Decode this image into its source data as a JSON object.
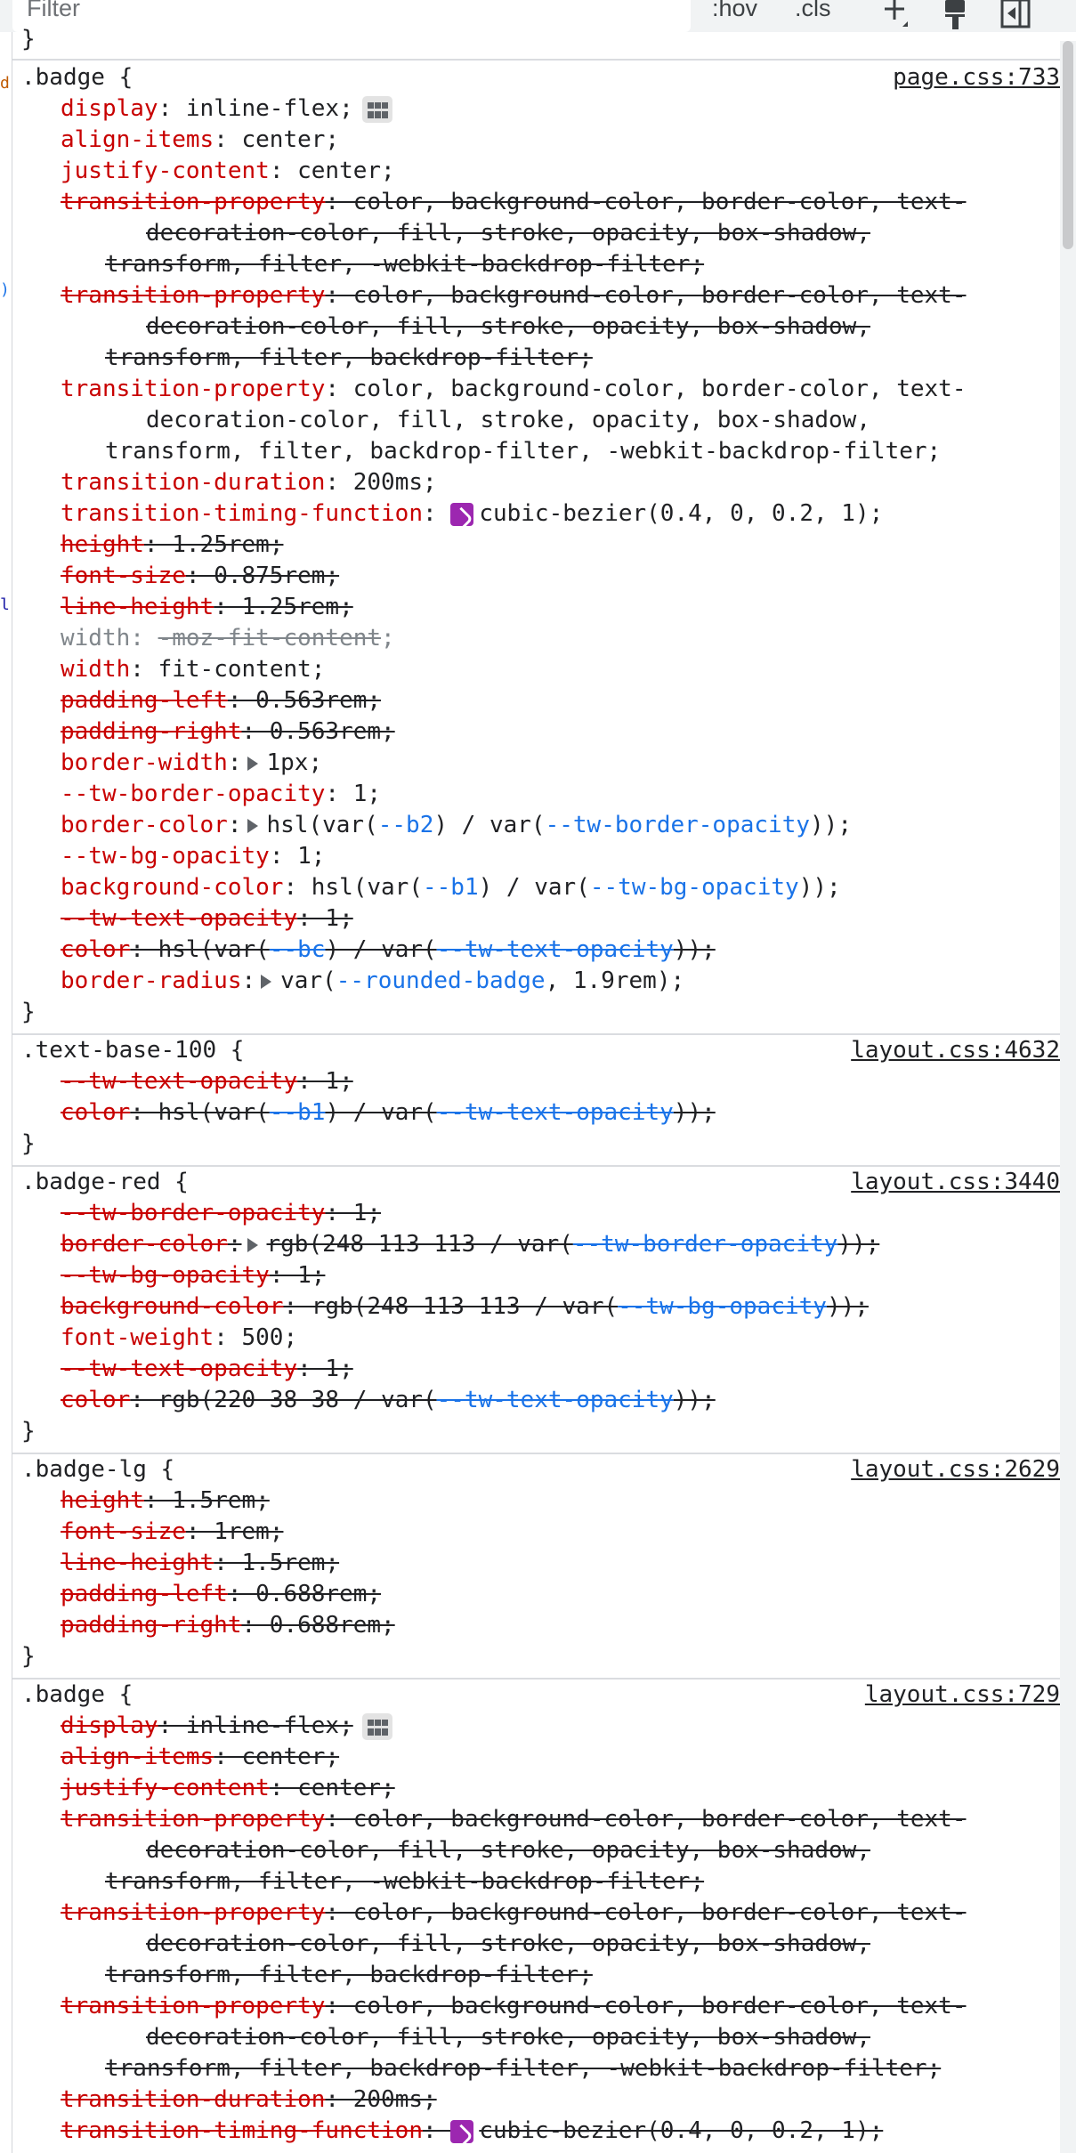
{
  "toolbar": {
    "filter_placeholder": "Filter",
    "hov": ":hov",
    "cls": ".cls"
  },
  "top_brace": "}",
  "rules": [
    {
      "selector": ".badge {",
      "source": "page.css:733",
      "lines": [
        {
          "lvl": 1,
          "segs": [
            {
              "t": "display",
              "c": "pn"
            },
            {
              "t": ": inline-flex;"
            }
          ],
          "flex": true
        },
        {
          "lvl": 1,
          "segs": [
            {
              "t": "align-items",
              "c": "pn"
            },
            {
              "t": ": center;"
            }
          ]
        },
        {
          "lvl": 1,
          "segs": [
            {
              "t": "justify-content",
              "c": "pn"
            },
            {
              "t": ": center;"
            }
          ]
        },
        {
          "lvl": 1,
          "strike": true,
          "segs": [
            {
              "t": "transition-property",
              "c": "pn"
            },
            {
              "t": ": color, background-color, border-color, text-"
            }
          ]
        },
        {
          "lvl": 2,
          "strike": true,
          "segs": [
            {
              "t": "decoration-color, fill, stroke, opacity, box-shadow,"
            }
          ]
        },
        {
          "lvl": 3,
          "strike": true,
          "segs": [
            {
              "t": "transform, filter, -webkit-backdrop-filter;"
            }
          ]
        },
        {
          "lvl": 1,
          "strike": true,
          "segs": [
            {
              "t": "transition-property",
              "c": "pn"
            },
            {
              "t": ": color, background-color, border-color, text-"
            }
          ]
        },
        {
          "lvl": 2,
          "strike": true,
          "segs": [
            {
              "t": "decoration-color, fill, stroke, opacity, box-shadow,"
            }
          ]
        },
        {
          "lvl": 3,
          "strike": true,
          "segs": [
            {
              "t": "transform, filter, backdrop-filter;"
            }
          ]
        },
        {
          "lvl": 1,
          "segs": [
            {
              "t": "transition-property",
              "c": "pn"
            },
            {
              "t": ": color, background-color, border-color, text-"
            }
          ]
        },
        {
          "lvl": 2,
          "segs": [
            {
              "t": "decoration-color, fill, stroke, opacity, box-shadow,"
            }
          ]
        },
        {
          "lvl": 3,
          "segs": [
            {
              "t": "transform, filter, backdrop-filter, -webkit-backdrop-filter;"
            }
          ]
        },
        {
          "lvl": 1,
          "segs": [
            {
              "t": "transition-duration",
              "c": "pn"
            },
            {
              "t": ": 200ms;"
            }
          ]
        },
        {
          "lvl": 1,
          "segs": [
            {
              "t": "transition-timing-function",
              "c": "pn"
            },
            {
              "t": ": "
            },
            {
              "ease": true
            },
            {
              "t": "cubic-bezier(0.4, 0, 0.2, 1);"
            }
          ]
        },
        {
          "lvl": 1,
          "strike": true,
          "segs": [
            {
              "t": "height",
              "c": "pn"
            },
            {
              "t": ": 1.25rem;"
            }
          ]
        },
        {
          "lvl": 1,
          "strike": true,
          "segs": [
            {
              "t": "font-size",
              "c": "pn"
            },
            {
              "t": ": 0.875rem;"
            }
          ]
        },
        {
          "lvl": 1,
          "strike": true,
          "segs": [
            {
              "t": "line-height",
              "c": "pn"
            },
            {
              "t": ": 1.25rem;"
            }
          ]
        },
        {
          "lvl": 1,
          "disabled": true,
          "segs": [
            {
              "t": "width: "
            },
            {
              "t": "-moz-fit-content",
              "c": "s"
            },
            {
              "t": ";"
            }
          ]
        },
        {
          "lvl": 1,
          "segs": [
            {
              "t": "width",
              "c": "pn"
            },
            {
              "t": ": fit-content;"
            }
          ]
        },
        {
          "lvl": 1,
          "strike": true,
          "segs": [
            {
              "t": "padding-left",
              "c": "pn"
            },
            {
              "t": ": 0.563rem;"
            }
          ]
        },
        {
          "lvl": 1,
          "strike": true,
          "segs": [
            {
              "t": "padding-right",
              "c": "pn"
            },
            {
              "t": ": 0.563rem;"
            }
          ]
        },
        {
          "lvl": 1,
          "segs": [
            {
              "t": "border-width",
              "c": "pn"
            },
            {
              "t": ":"
            },
            {
              "tri": true
            },
            {
              "t": "1px;"
            }
          ]
        },
        {
          "lvl": 1,
          "segs": [
            {
              "t": "--tw-border-opacity",
              "c": "pn"
            },
            {
              "t": ": 1;"
            }
          ]
        },
        {
          "lvl": 1,
          "segs": [
            {
              "t": "border-color",
              "c": "pn"
            },
            {
              "t": ":"
            },
            {
              "tri": true
            },
            {
              "t": "hsl(var("
            },
            {
              "t": "--b2",
              "c": "var"
            },
            {
              "t": ") / var("
            },
            {
              "t": "--tw-border-opacity",
              "c": "var"
            },
            {
              "t": "));"
            }
          ]
        },
        {
          "lvl": 1,
          "segs": [
            {
              "t": "--tw-bg-opacity",
              "c": "pn"
            },
            {
              "t": ": 1;"
            }
          ]
        },
        {
          "lvl": 1,
          "segs": [
            {
              "t": "background-color",
              "c": "pn"
            },
            {
              "t": ": hsl(var("
            },
            {
              "t": "--b1",
              "c": "var"
            },
            {
              "t": ") / var("
            },
            {
              "t": "--tw-bg-opacity",
              "c": "var"
            },
            {
              "t": "));"
            }
          ]
        },
        {
          "lvl": 1,
          "strike": true,
          "segs": [
            {
              "t": "--tw-text-opacity",
              "c": "pn"
            },
            {
              "t": ": 1;"
            }
          ]
        },
        {
          "lvl": 1,
          "strike": true,
          "segs": [
            {
              "t": "color",
              "c": "pn"
            },
            {
              "t": ": hsl(var("
            },
            {
              "t": "--bc",
              "c": "var"
            },
            {
              "t": ") / var("
            },
            {
              "t": "--tw-text-opacity",
              "c": "var"
            },
            {
              "t": "));"
            }
          ]
        },
        {
          "lvl": 1,
          "segs": [
            {
              "t": "border-radius",
              "c": "pn"
            },
            {
              "t": ":"
            },
            {
              "tri": true
            },
            {
              "t": "var("
            },
            {
              "t": "--rounded-badge",
              "c": "var"
            },
            {
              "t": ", 1.9rem);"
            }
          ]
        }
      ]
    },
    {
      "selector": ".text-base-100 {",
      "source": "layout.css:4632",
      "lines": [
        {
          "lvl": 1,
          "strike": true,
          "segs": [
            {
              "t": "--tw-text-opacity",
              "c": "pn"
            },
            {
              "t": ": 1;"
            }
          ]
        },
        {
          "lvl": 1,
          "strike": true,
          "segs": [
            {
              "t": "color",
              "c": "pn"
            },
            {
              "t": ": hsl(var("
            },
            {
              "t": "--b1",
              "c": "var"
            },
            {
              "t": ") / var("
            },
            {
              "t": "--tw-text-opacity",
              "c": "var"
            },
            {
              "t": "));"
            }
          ]
        }
      ]
    },
    {
      "selector": ".badge-red {",
      "source": "layout.css:3440",
      "lines": [
        {
          "lvl": 1,
          "strike": true,
          "segs": [
            {
              "t": "--tw-border-opacity",
              "c": "pn"
            },
            {
              "t": ": 1;"
            }
          ]
        },
        {
          "lvl": 1,
          "strike": true,
          "segs": [
            {
              "t": "border-color",
              "c": "pn"
            },
            {
              "t": ":"
            },
            {
              "tri": true
            },
            {
              "t": "rgb(248 113 113 / var("
            },
            {
              "t": "--tw-border-opacity",
              "c": "var"
            },
            {
              "t": "));"
            }
          ]
        },
        {
          "lvl": 1,
          "strike": true,
          "segs": [
            {
              "t": "--tw-bg-opacity",
              "c": "pn"
            },
            {
              "t": ": 1;"
            }
          ]
        },
        {
          "lvl": 1,
          "strike": true,
          "segs": [
            {
              "t": "background-color",
              "c": "pn"
            },
            {
              "t": ": rgb(248 113 113 / var("
            },
            {
              "t": "--tw-bg-opacity",
              "c": "var"
            },
            {
              "t": "));"
            }
          ]
        },
        {
          "lvl": 1,
          "segs": [
            {
              "t": "font-weight",
              "c": "pn"
            },
            {
              "t": ": 500;"
            }
          ]
        },
        {
          "lvl": 1,
          "strike": true,
          "segs": [
            {
              "t": "--tw-text-opacity",
              "c": "pn"
            },
            {
              "t": ": 1;"
            }
          ]
        },
        {
          "lvl": 1,
          "strike": true,
          "segs": [
            {
              "t": "color",
              "c": "pn"
            },
            {
              "t": ": rgb(220 38 38 / var("
            },
            {
              "t": "--tw-text-opacity",
              "c": "var"
            },
            {
              "t": "));"
            }
          ]
        }
      ]
    },
    {
      "selector": ".badge-lg {",
      "source": "layout.css:2629",
      "lines": [
        {
          "lvl": 1,
          "strike": true,
          "segs": [
            {
              "t": "height",
              "c": "pn"
            },
            {
              "t": ": 1.5rem;"
            }
          ]
        },
        {
          "lvl": 1,
          "strike": true,
          "segs": [
            {
              "t": "font-size",
              "c": "pn"
            },
            {
              "t": ": 1rem;"
            }
          ]
        },
        {
          "lvl": 1,
          "strike": true,
          "segs": [
            {
              "t": "line-height",
              "c": "pn"
            },
            {
              "t": ": 1.5rem;"
            }
          ]
        },
        {
          "lvl": 1,
          "strike": true,
          "segs": [
            {
              "t": "padding-left",
              "c": "pn"
            },
            {
              "t": ": 0.688rem;"
            }
          ]
        },
        {
          "lvl": 1,
          "strike": true,
          "segs": [
            {
              "t": "padding-right",
              "c": "pn"
            },
            {
              "t": ": 0.688rem;"
            }
          ]
        }
      ]
    },
    {
      "selector": ".badge {",
      "source": "layout.css:729",
      "open": true,
      "lines": [
        {
          "lvl": 1,
          "strike": true,
          "segs": [
            {
              "t": "display",
              "c": "pn"
            },
            {
              "t": ": inline-flex;"
            }
          ],
          "flex": true
        },
        {
          "lvl": 1,
          "strike": true,
          "segs": [
            {
              "t": "align-items",
              "c": "pn"
            },
            {
              "t": ": center;"
            }
          ]
        },
        {
          "lvl": 1,
          "strike": true,
          "segs": [
            {
              "t": "justify-content",
              "c": "pn"
            },
            {
              "t": ": center;"
            }
          ]
        },
        {
          "lvl": 1,
          "strike": true,
          "segs": [
            {
              "t": "transition-property",
              "c": "pn"
            },
            {
              "t": ": color, background-color, border-color, text-"
            }
          ]
        },
        {
          "lvl": 2,
          "strike": true,
          "segs": [
            {
              "t": "decoration-color, fill, stroke, opacity, box-shadow,"
            }
          ]
        },
        {
          "lvl": 3,
          "strike": true,
          "segs": [
            {
              "t": "transform, filter, -webkit-backdrop-filter;"
            }
          ]
        },
        {
          "lvl": 1,
          "strike": true,
          "segs": [
            {
              "t": "transition-property",
              "c": "pn"
            },
            {
              "t": ": color, background-color, border-color, text-"
            }
          ]
        },
        {
          "lvl": 2,
          "strike": true,
          "segs": [
            {
              "t": "decoration-color, fill, stroke, opacity, box-shadow,"
            }
          ]
        },
        {
          "lvl": 3,
          "strike": true,
          "segs": [
            {
              "t": "transform, filter, backdrop-filter;"
            }
          ]
        },
        {
          "lvl": 1,
          "strike": true,
          "segs": [
            {
              "t": "transition-property",
              "c": "pn"
            },
            {
              "t": ": color, background-color, border-color, text-"
            }
          ]
        },
        {
          "lvl": 2,
          "strike": true,
          "segs": [
            {
              "t": "decoration-color, fill, stroke, opacity, box-shadow,"
            }
          ]
        },
        {
          "lvl": 3,
          "strike": true,
          "segs": [
            {
              "t": "transform, filter, backdrop-filter, -webkit-backdrop-filter;"
            }
          ]
        },
        {
          "lvl": 1,
          "strike": true,
          "segs": [
            {
              "t": "transition-duration",
              "c": "pn"
            },
            {
              "t": ": 200ms;"
            }
          ]
        },
        {
          "lvl": 1,
          "strike": true,
          "segs": [
            {
              "t": "transition-timing-function",
              "c": "pn"
            },
            {
              "t": ": "
            },
            {
              "ease": true
            },
            {
              "t": "cubic-bezier(0.4, 0, 0.2, 1);"
            }
          ]
        }
      ]
    }
  ]
}
